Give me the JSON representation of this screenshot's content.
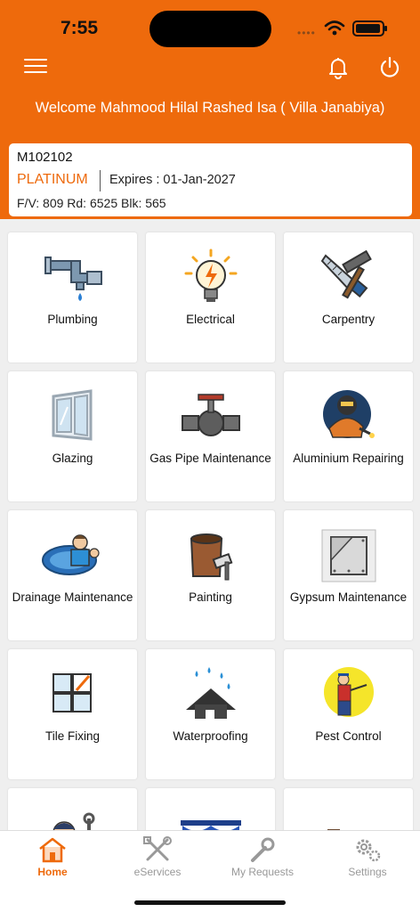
{
  "status_bar": {
    "time": "7:55",
    "signal": "••••"
  },
  "header": {
    "welcome": "Welcome Mahmood Hilal Rashed Isa ( Villa Janabiya)"
  },
  "member": {
    "id": "M102102",
    "tier": "PLATINUM",
    "expires": "Expires : 01-Jan-2027",
    "address": "F/V: 809 Rd: 6525 Blk: 565"
  },
  "services": [
    {
      "label": "Plumbing",
      "icon": "plumbing-icon"
    },
    {
      "label": "Electrical",
      "icon": "electrical-icon"
    },
    {
      "label": "Carpentry",
      "icon": "carpentry-icon"
    },
    {
      "label": "Glazing",
      "icon": "glazing-icon"
    },
    {
      "label": "Gas Pipe Maintenance",
      "icon": "gas-pipe-icon"
    },
    {
      "label": "Aluminium Repairing",
      "icon": "welder-icon"
    },
    {
      "label": "Drainage Maintenance",
      "icon": "drainage-icon"
    },
    {
      "label": "Painting",
      "icon": "paint-bucket-icon"
    },
    {
      "label": "Gypsum Maintenance",
      "icon": "gypsum-board-icon"
    },
    {
      "label": "Tile Fixing",
      "icon": "tile-icon"
    },
    {
      "label": "Waterproofing",
      "icon": "waterproof-roof-icon"
    },
    {
      "label": "Pest Control",
      "icon": "pest-control-icon"
    }
  ],
  "partial_services": [
    {
      "icon": "mechanic-icon"
    },
    {
      "icon": "curtain-icon"
    },
    {
      "icon": "furniture-icon"
    }
  ],
  "tabs": [
    {
      "label": "Home",
      "icon": "home-icon",
      "active": true
    },
    {
      "label": "eServices",
      "icon": "tools-icon",
      "active": false
    },
    {
      "label": "My Requests",
      "icon": "wrench-icon",
      "active": false
    },
    {
      "label": "Settings",
      "icon": "gear-icon",
      "active": false
    }
  ],
  "colors": {
    "brand": "#ee6a0c",
    "background": "#efefef",
    "tab_inactive": "#999999"
  }
}
